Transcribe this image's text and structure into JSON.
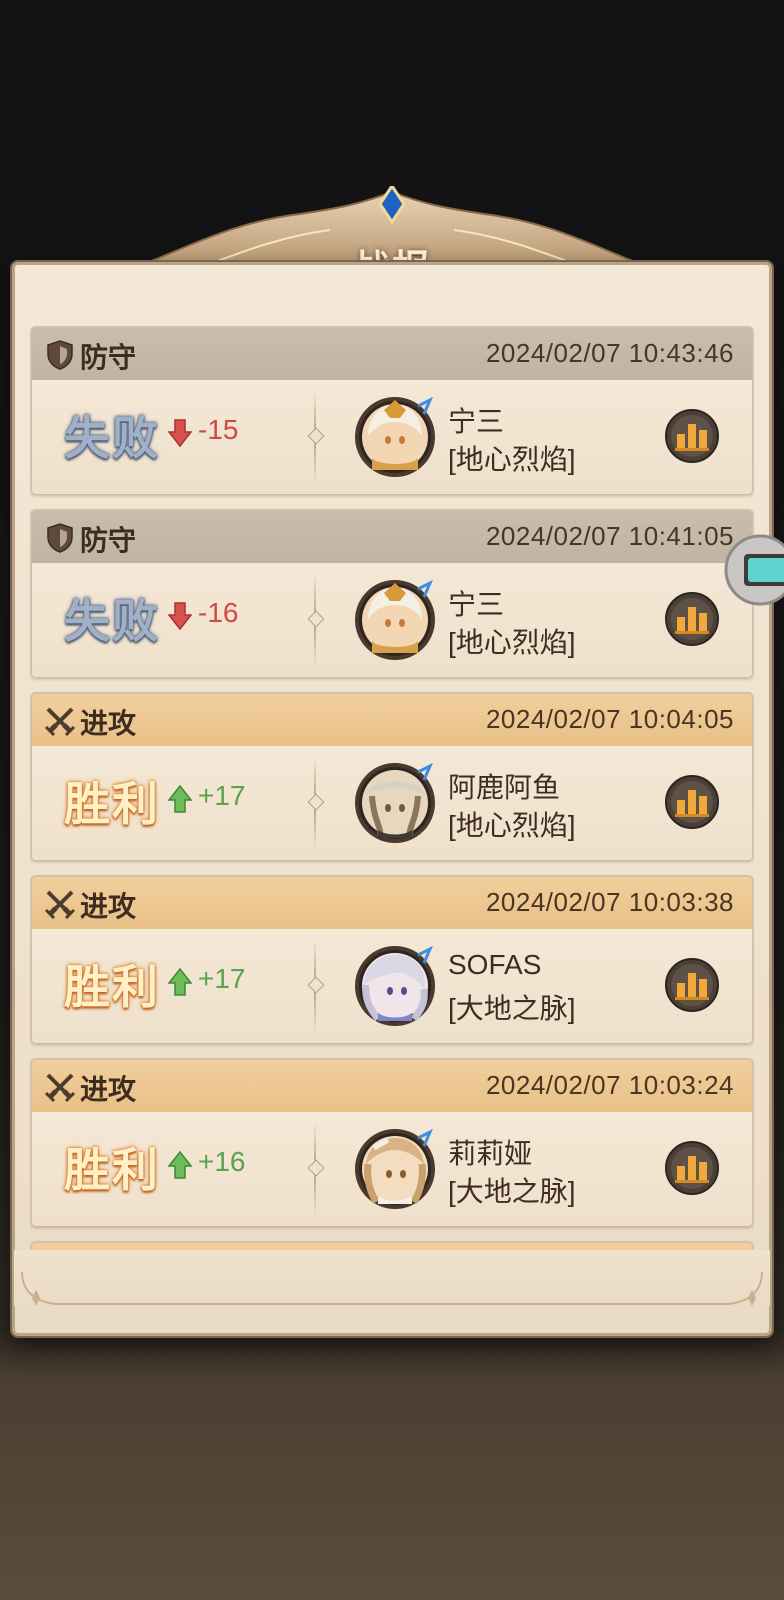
{
  "window": {
    "title": "战报"
  },
  "reports": [
    {
      "kind": "defense",
      "type_label": "防守",
      "timestamp": "2024/02/07 10:43:46",
      "result": "失败",
      "outcome": "lose",
      "delta": "-15",
      "opponent": {
        "name": "宁三",
        "guild": "[地心烈焰]",
        "avatar": "avatar-ningsan"
      }
    },
    {
      "kind": "defense",
      "type_label": "防守",
      "timestamp": "2024/02/07 10:41:05",
      "result": "失败",
      "outcome": "lose",
      "delta": "-16",
      "opponent": {
        "name": "宁三",
        "guild": "[地心烈焰]",
        "avatar": "avatar-ningsan"
      }
    },
    {
      "kind": "attack",
      "type_label": "进攻",
      "timestamp": "2024/02/07 10:04:05",
      "result": "胜利",
      "outcome": "win",
      "delta": "+17",
      "opponent": {
        "name": "阿鹿阿鱼",
        "guild": "[地心烈焰]",
        "avatar": "avatar-aluayu"
      }
    },
    {
      "kind": "attack",
      "type_label": "进攻",
      "timestamp": "2024/02/07 10:03:38",
      "result": "胜利",
      "outcome": "win",
      "delta": "+17",
      "opponent": {
        "name": "SOFAS",
        "guild": "[大地之脉]",
        "avatar": "avatar-sofas"
      }
    },
    {
      "kind": "attack",
      "type_label": "进攻",
      "timestamp": "2024/02/07 10:03:24",
      "result": "胜利",
      "outcome": "win",
      "delta": "+16",
      "opponent": {
        "name": "莉莉娅",
        "guild": "[大地之脉]",
        "avatar": "avatar-liliya"
      }
    }
  ],
  "icons": {
    "defense": "shield-icon",
    "attack": "crossed-swords-icon",
    "detail": "bar-chart-icon",
    "lose_arrow": "arrow-down-icon",
    "win_arrow": "arrow-up-icon"
  },
  "colors": {
    "defense_header": "#c9bdac",
    "attack_header": "#f1cf9c",
    "lose_delta": "#cf4a45",
    "win_delta": "#5aa24e"
  }
}
